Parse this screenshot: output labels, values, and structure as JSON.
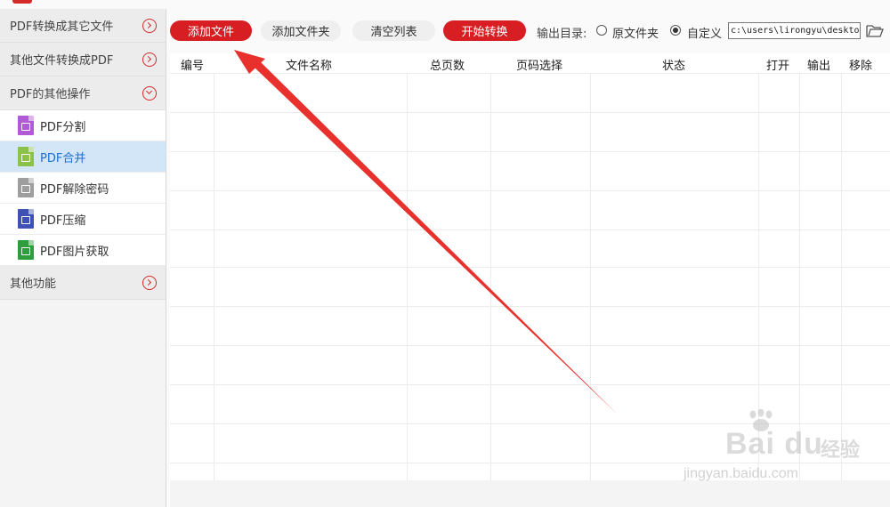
{
  "sidebar": {
    "categories": [
      {
        "label": "PDF转换成其它文件",
        "state": "collapsed"
      },
      {
        "label": "其他文件转换成PDF",
        "state": "collapsed"
      },
      {
        "label": "PDF的其他操作",
        "state": "expanded"
      },
      {
        "label": "其他功能",
        "state": "collapsed"
      }
    ],
    "items": [
      {
        "label": "PDF分割",
        "icon": "pdf-split-icon",
        "color": "#b05ad6"
      },
      {
        "label": "PDF合并",
        "icon": "pdf-merge-icon",
        "color": "#8bc34a",
        "active": true
      },
      {
        "label": "PDF解除密码",
        "icon": "pdf-unlock-icon",
        "color": "#9e9e9e"
      },
      {
        "label": "PDF压缩",
        "icon": "pdf-compress-icon",
        "color": "#3f51b5"
      },
      {
        "label": "PDF图片获取",
        "icon": "pdf-image-icon",
        "color": "#2e9d3e"
      }
    ]
  },
  "toolbar": {
    "add_file": "添加文件",
    "add_folder": "添加文件夹",
    "clear_list": "清空列表",
    "start": "开始转换",
    "output_label": "输出目录:",
    "radio_original": "原文件夹",
    "radio_custom": "自定义",
    "selected_output": "自定义",
    "output_path": "c:\\users\\lirongyu\\desktop"
  },
  "table": {
    "headers": [
      "编号",
      "文件名称",
      "总页数",
      "页码选择",
      "状态",
      "打开",
      "输出",
      "移除"
    ],
    "rows": []
  },
  "watermark": {
    "brand": "Bai du",
    "cn": "经验",
    "url": "jingyan.baidu.com"
  },
  "colors": {
    "accent_red": "#d71e23",
    "active_bg": "#d3e6f8",
    "active_text": "#1c6fd1",
    "annotation_arrow": "#e8302c"
  }
}
